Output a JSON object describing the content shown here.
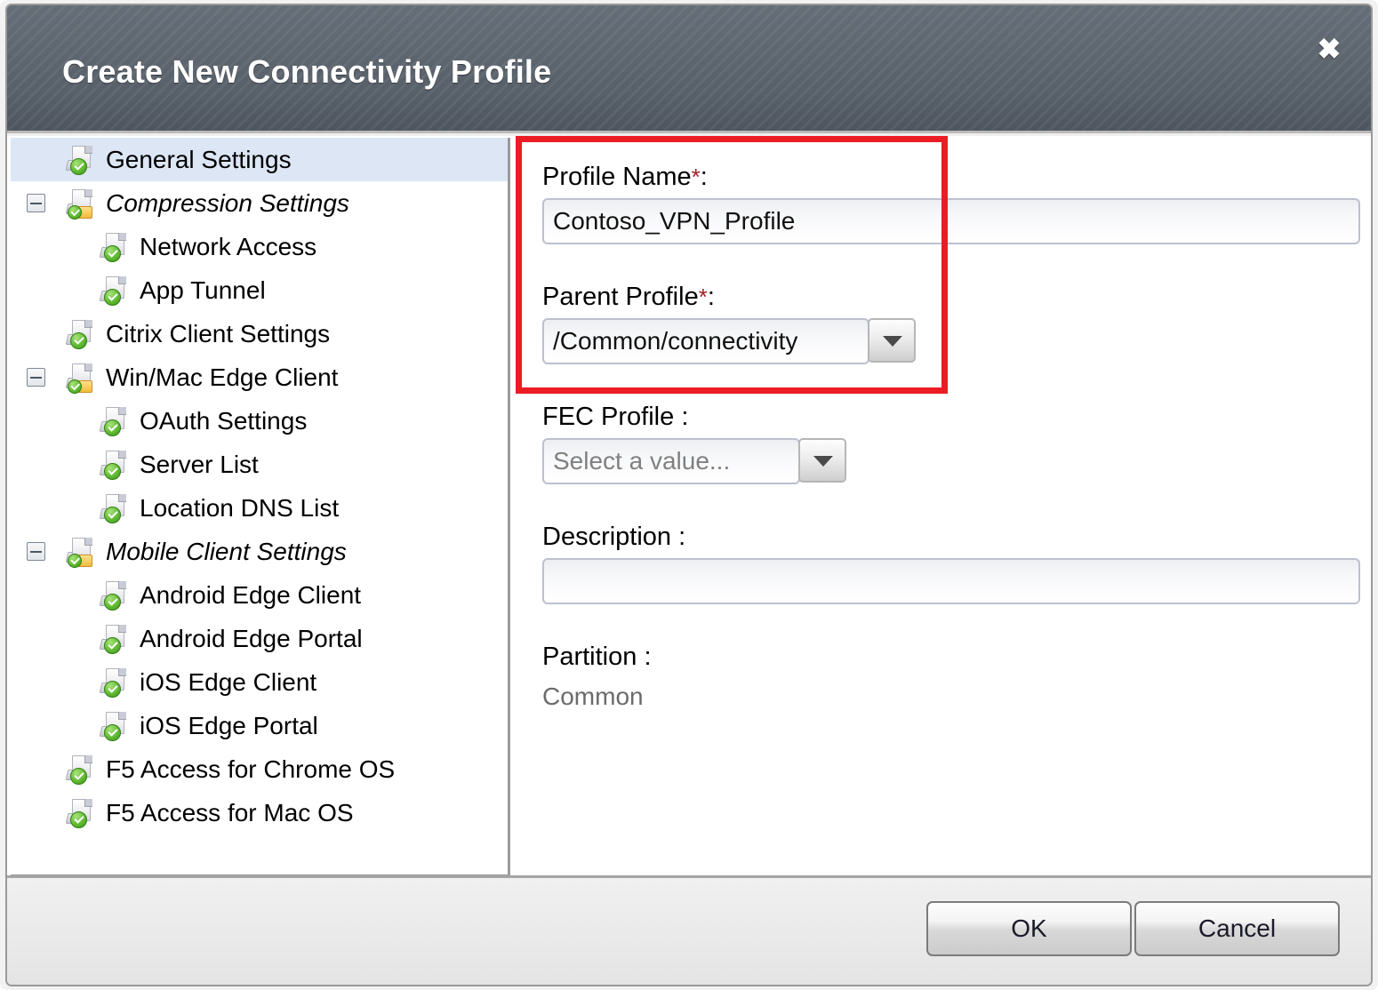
{
  "dialog": {
    "title": "Create New Connectivity Profile",
    "close_icon": "close-icon",
    "close_glyph": "✖"
  },
  "tree": {
    "items": [
      {
        "label": "General Settings",
        "level": 0,
        "icon": "document-check-icon",
        "selected": true,
        "italic": false,
        "twisty": false
      },
      {
        "label": "Compression Settings",
        "level": 0,
        "icon": "folder-check-icon",
        "selected": false,
        "italic": true,
        "twisty": true
      },
      {
        "label": "Network Access",
        "level": 1,
        "icon": "document-check-icon",
        "selected": false,
        "italic": false,
        "twisty": false
      },
      {
        "label": "App Tunnel",
        "level": 1,
        "icon": "document-check-icon",
        "selected": false,
        "italic": false,
        "twisty": false
      },
      {
        "label": "Citrix Client Settings",
        "level": 0,
        "icon": "document-check-icon",
        "selected": false,
        "italic": false,
        "twisty": false
      },
      {
        "label": "Win/Mac Edge Client",
        "level": 0,
        "icon": "folder-check-icon",
        "selected": false,
        "italic": false,
        "twisty": true
      },
      {
        "label": "OAuth Settings",
        "level": 1,
        "icon": "document-check-icon",
        "selected": false,
        "italic": false,
        "twisty": false
      },
      {
        "label": "Server List",
        "level": 1,
        "icon": "document-check-icon",
        "selected": false,
        "italic": false,
        "twisty": false
      },
      {
        "label": "Location DNS List",
        "level": 1,
        "icon": "document-check-icon",
        "selected": false,
        "italic": false,
        "twisty": false
      },
      {
        "label": "Mobile Client Settings",
        "level": 0,
        "icon": "folder-check-icon",
        "selected": false,
        "italic": true,
        "twisty": true
      },
      {
        "label": "Android Edge Client",
        "level": 1,
        "icon": "document-check-icon",
        "selected": false,
        "italic": false,
        "twisty": false
      },
      {
        "label": "Android Edge Portal",
        "level": 1,
        "icon": "document-check-icon",
        "selected": false,
        "italic": false,
        "twisty": false
      },
      {
        "label": "iOS Edge Client",
        "level": 1,
        "icon": "document-check-icon",
        "selected": false,
        "italic": false,
        "twisty": false
      },
      {
        "label": "iOS Edge Portal",
        "level": 1,
        "icon": "document-check-icon",
        "selected": false,
        "italic": false,
        "twisty": false
      },
      {
        "label": "F5 Access for Chrome OS",
        "level": 0,
        "icon": "document-check-icon",
        "selected": false,
        "italic": false,
        "twisty": false
      },
      {
        "label": "F5 Access for Mac OS",
        "level": 0,
        "icon": "document-check-icon",
        "selected": false,
        "italic": false,
        "twisty": false
      }
    ]
  },
  "form": {
    "profile_name": {
      "label": "Profile Name",
      "required_mark": "*",
      "label_suffix": ":",
      "value": "Contoso_VPN_Profile"
    },
    "parent_profile": {
      "label": "Parent Profile",
      "required_mark": "*",
      "label_suffix": ":",
      "value": "/Common/connectivity",
      "dropdown_icon": "chevron-down-icon"
    },
    "fec_profile": {
      "label": "FEC Profile :",
      "value": "",
      "placeholder": "Select a value...",
      "dropdown_icon": "chevron-down-icon"
    },
    "description": {
      "label": "Description :",
      "value": "",
      "placeholder": ""
    },
    "partition": {
      "label": "Partition :",
      "value": "Common"
    }
  },
  "footer": {
    "ok_label": "OK",
    "cancel_label": "Cancel"
  },
  "colors": {
    "accent_red": "#ec1c24",
    "required_star": "#a01f25",
    "titlebar": "#5b636e",
    "selection": "#dce6f5"
  }
}
